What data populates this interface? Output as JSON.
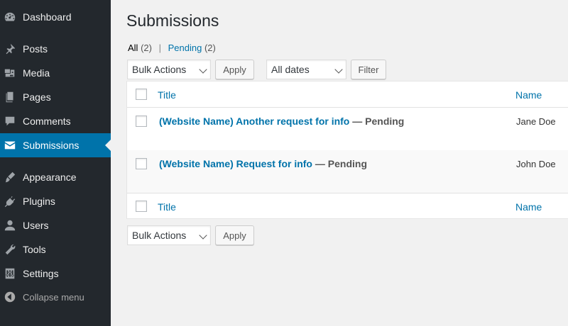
{
  "sidebar": {
    "items": [
      {
        "label": "Dashboard",
        "icon": "dashboard-icon"
      },
      {
        "label": "Posts",
        "icon": "pin-icon"
      },
      {
        "label": "Media",
        "icon": "media-icon"
      },
      {
        "label": "Pages",
        "icon": "pages-icon"
      },
      {
        "label": "Comments",
        "icon": "comments-icon"
      },
      {
        "label": "Submissions",
        "icon": "mail-icon",
        "active": true
      },
      {
        "label": "Appearance",
        "icon": "brush-icon"
      },
      {
        "label": "Plugins",
        "icon": "plugin-icon"
      },
      {
        "label": "Users",
        "icon": "user-icon"
      },
      {
        "label": "Tools",
        "icon": "wrench-icon"
      },
      {
        "label": "Settings",
        "icon": "sliders-icon"
      }
    ],
    "collapse_label": "Collapse menu"
  },
  "page": {
    "title": "Submissions"
  },
  "views": {
    "all_label": "All",
    "all_count": "(2)",
    "separator": "|",
    "pending_label": "Pending",
    "pending_count": "(2)"
  },
  "toolbar_top": {
    "bulk_actions": "Bulk Actions",
    "apply": "Apply",
    "dates": "All dates",
    "filter": "Filter"
  },
  "toolbar_bottom": {
    "bulk_actions": "Bulk Actions",
    "apply": "Apply"
  },
  "table": {
    "columns": {
      "title": "Title",
      "name": "Name"
    },
    "rows": [
      {
        "title": "(Website Name) Another request for info",
        "state": " — Pending",
        "name": "Jane Doe"
      },
      {
        "title": "(Website Name) Request for info",
        "state": " — Pending",
        "name": "John Doe"
      }
    ]
  },
  "colors": {
    "sidebar_bg": "#23282d",
    "accent": "#0073aa",
    "page_bg": "#f1f1f1"
  }
}
